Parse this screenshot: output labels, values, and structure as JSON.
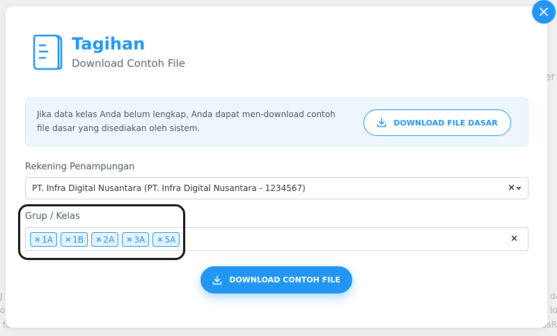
{
  "modal": {
    "title": "Tagihan",
    "subtitle": "Download Contoh File",
    "close_icon": "close-icon",
    "header_icon": "document-icon"
  },
  "info": {
    "text": "Jika data kelas Anda belum lengkap, Anda dapat men-download contoh file dasar yang disediakan oleh sistem.",
    "button_label": "DOWNLOAD FILE DASAR",
    "button_icon": "download-icon"
  },
  "rekening": {
    "label": "Rekening Penampungan",
    "value": "PT. Infra Digital Nusantara (PT. Infra Digital Nusantara - 1234567)",
    "clear": "×"
  },
  "grup": {
    "label": "Grup / Kelas",
    "tags": [
      "1A",
      "1B",
      "2A",
      "3A",
      "5A"
    ],
    "tag_remove": "×",
    "clear": "×"
  },
  "primary_button": {
    "label": "DOWNLOAD CONTOH FILE",
    "icon": "download-icon"
  },
  "colors": {
    "accent": "#2196f3",
    "info_bg": "#eef6fd",
    "highlight": "#111111"
  }
}
